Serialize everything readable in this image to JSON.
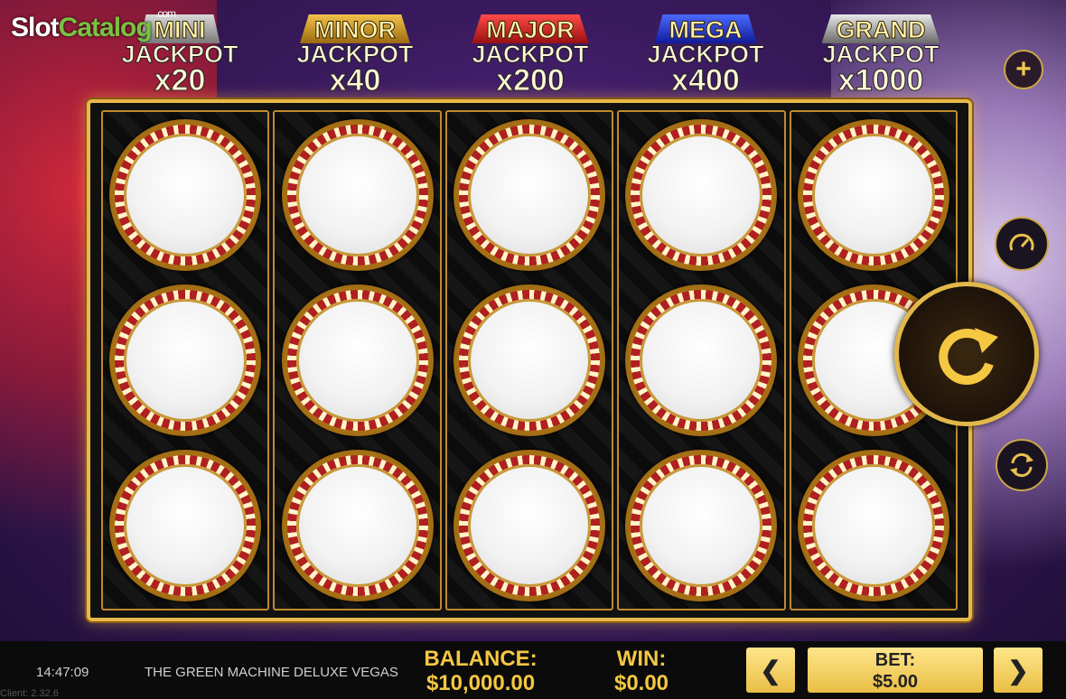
{
  "watermark": {
    "part1": "Slot",
    "part2": "Catalog",
    "suffix": ".com"
  },
  "jackpots": [
    {
      "tier": "MINI",
      "label": "JACKPOT",
      "multiplier": "x20",
      "color": "#9a9a9a"
    },
    {
      "tier": "MINOR",
      "label": "JACKPOT",
      "multiplier": "x40",
      "color": "#c8962a"
    },
    {
      "tier": "MAJOR",
      "label": "JACKPOT",
      "multiplier": "x200",
      "color": "#c8202a"
    },
    {
      "tier": "MEGA",
      "label": "JACKPOT",
      "multiplier": "x400",
      "color": "#1a3cc8"
    },
    {
      "tier": "GRAND",
      "label": "JACKPOT",
      "multiplier": "x1000",
      "color": "#8a8a8a"
    }
  ],
  "grid": {
    "columns": 5,
    "rows": 3
  },
  "side_buttons": {
    "plus": "+",
    "speed": "speed-icon",
    "spin": "spin-icon",
    "autoplay": "autoplay-icon"
  },
  "footer": {
    "time": "14:47:09",
    "client": "Client: 2.32.6",
    "game_name": "THE GREEN MACHINE DELUXE VEGAS",
    "balance_label": "BALANCE:",
    "balance_value": "$10,000.00",
    "win_label": "WIN:",
    "win_value": "$0.00",
    "bet_label": "BET:",
    "bet_value": "$5.00",
    "prev": "❮",
    "next": "❯"
  }
}
